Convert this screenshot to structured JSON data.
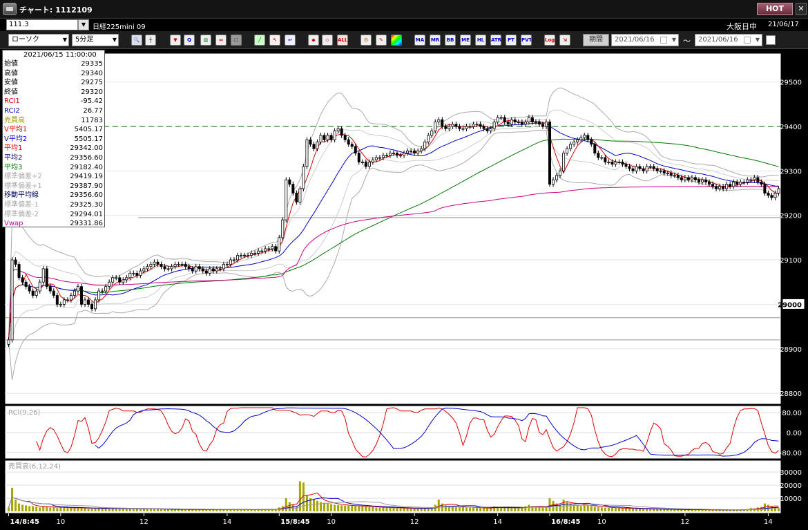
{
  "window": {
    "title": "チャート: 1112109",
    "hot_label": "HOT",
    "close_label": "✕"
  },
  "header": {
    "code": "111.3",
    "symbol": "日経225mini 09",
    "market": "大阪日中",
    "date": "21/06/17"
  },
  "toolbar": {
    "chart_type": "ローソク",
    "interval": "5分足",
    "period_label": "期間",
    "date_from": "2021/06/16",
    "date_to": "2021/06/16",
    "tilde": "～",
    "buttons": [
      "zoom",
      "cursor",
      "buy",
      "sell",
      "compare",
      "scale",
      "delete",
      "draw",
      "pointer",
      "arrow",
      "order1",
      "order2",
      "all",
      "settings",
      "tools",
      "color",
      "MA",
      "MR",
      "BB",
      "ME",
      "HL",
      "ATR",
      "PT",
      "PVT",
      "Log",
      "export"
    ],
    "button_labels": {
      "all": "ALL",
      "ma": "MA",
      "mr": "MR",
      "bb": "BB",
      "me": "ME",
      "hl": "HL",
      "atr": "ATR",
      "pt": "PT",
      "pvt": "PVT",
      "log": "Log"
    }
  },
  "info": {
    "datetime": "2021/06/15 11:00:00",
    "rows": [
      {
        "label": "始値",
        "value": "29335",
        "color": "#000000"
      },
      {
        "label": "高値",
        "value": "29340",
        "color": "#000000"
      },
      {
        "label": "安値",
        "value": "29275",
        "color": "#000000"
      },
      {
        "label": "終値",
        "value": "29320",
        "color": "#000000"
      },
      {
        "label": "RCI1",
        "value": "-95.42",
        "color": "#dd0000"
      },
      {
        "label": "RCI2",
        "value": "26.77",
        "color": "#0000cc"
      },
      {
        "label": "売買高",
        "value": "11783",
        "color": "#999900"
      },
      {
        "label": "V平均1",
        "value": "5405.17",
        "color": "#dd0000"
      },
      {
        "label": "V平均2",
        "value": "5505.17",
        "color": "#0000cc"
      },
      {
        "label": "平均1",
        "value": "29342.00",
        "color": "#dd0000"
      },
      {
        "label": "平均2",
        "value": "29356.60",
        "color": "#000066"
      },
      {
        "label": "平均3",
        "value": "29182.40",
        "color": "#007700"
      },
      {
        "label": "標準偏差+2",
        "value": "29419.19",
        "color": "#aaaaaa"
      },
      {
        "label": "標準偏差+1",
        "value": "29387.90",
        "color": "#aaaaaa"
      },
      {
        "label": "移動平均線",
        "value": "29356.60",
        "color": "#000066"
      },
      {
        "label": "標準偏差-1",
        "value": "29325.30",
        "color": "#aaaaaa"
      },
      {
        "label": "標準偏差-2",
        "value": "29294.01",
        "color": "#aaaaaa"
      },
      {
        "label": "Vwap",
        "value": "29331.86",
        "color": "#cc00aa"
      }
    ]
  },
  "chart_data": {
    "type": "candlestick",
    "price_axis": {
      "ylim": [
        28780,
        29560
      ],
      "ticks": [
        "29500",
        "29400",
        "29300",
        "29200",
        "29100",
        "29000",
        "28900",
        "28800"
      ],
      "highlight": "29000"
    },
    "rci": {
      "label": "RCI(9,26)",
      "ylim": [
        -100,
        100
      ],
      "ticks": [
        "80.00",
        "0.00",
        "-80.00"
      ]
    },
    "volume": {
      "label": "売買高(6,12,24)",
      "ylim": [
        0,
        38000
      ],
      "ticks": [
        "30000",
        "20000",
        "10000"
      ]
    },
    "x_labels": [
      {
        "i": 0,
        "t": "14/8:45",
        "b": 1
      },
      {
        "i": 15,
        "t": "10",
        "b": 0
      },
      {
        "i": 39,
        "t": "12",
        "b": 0
      },
      {
        "i": 63,
        "t": "14",
        "b": 0
      },
      {
        "i": 78,
        "t": "15/8:45",
        "b": 1
      },
      {
        "i": 93,
        "t": "10",
        "b": 0
      },
      {
        "i": 117,
        "t": "12",
        "b": 0
      },
      {
        "i": 141,
        "t": "14",
        "b": 0
      },
      {
        "i": 156,
        "t": "16/8:45",
        "b": 1
      },
      {
        "i": 171,
        "t": "10",
        "b": 0
      },
      {
        "i": 195,
        "t": "12",
        "b": 0
      },
      {
        "i": 219,
        "t": "14",
        "b": 0
      }
    ],
    "dashed_level": 29400,
    "closes": [
      28920,
      29100,
      29090,
      29060,
      29050,
      29040,
      29030,
      29020,
      29030,
      29050,
      29080,
      29040,
      29030,
      29020,
      29000,
      29000,
      29010,
      29010,
      29020,
      29030,
      29040,
      29000,
      29010,
      29000,
      28990,
      29010,
      29030,
      29030,
      29040,
      29050,
      29060,
      29060,
      29050,
      29055,
      29060,
      29070,
      29070,
      29065,
      29075,
      29080,
      29085,
      29090,
      29095,
      29090,
      29085,
      29080,
      29080,
      29085,
      29090,
      29090,
      29090,
      29085,
      29080,
      29075,
      29085,
      29080,
      29075,
      29070,
      29080,
      29075,
      29080,
      29080,
      29090,
      29090,
      29100,
      29100,
      29110,
      29110,
      29110,
      29110,
      29115,
      29115,
      29120,
      29120,
      29125,
      29125,
      29130,
      29120,
      29150,
      29190,
      29280,
      29270,
      29250,
      29230,
      29260,
      29310,
      29370,
      29360,
      29350,
      29365,
      29380,
      29370,
      29380,
      29370,
      29390,
      29395,
      29380,
      29370,
      29360,
      29355,
      29340,
      29320,
      29320,
      29310,
      29320,
      29325,
      29330,
      29330,
      29335,
      29335,
      29340,
      29340,
      29335,
      29335,
      29340,
      29345,
      29345,
      29340,
      29345,
      29350,
      29365,
      29380,
      29390,
      29410,
      29415,
      29400,
      29395,
      29400,
      29405,
      29400,
      29395,
      29395,
      29400,
      29400,
      29405,
      29405,
      29400,
      29395,
      29390,
      29395,
      29410,
      29420,
      29420,
      29410,
      29405,
      29415,
      29410,
      29410,
      29405,
      29410,
      29420,
      29410,
      29410,
      29405,
      29400,
      29410,
      29270,
      29280,
      29290,
      29300,
      29340,
      29350,
      29360,
      29365,
      29370,
      29375,
      29380,
      29370,
      29360,
      29340,
      29330,
      29330,
      29320,
      29320,
      29315,
      29320,
      29320,
      29315,
      29310,
      29305,
      29300,
      29310,
      29305,
      29300,
      29310,
      29310,
      29305,
      29300,
      29300,
      29295,
      29295,
      29290,
      29290,
      29285,
      29280,
      29285,
      29280,
      29285,
      29280,
      29275,
      29280,
      29275,
      29270,
      29265,
      29260,
      29265,
      29260,
      29270,
      29265,
      29275,
      29270,
      29275,
      29275,
      29280,
      29280,
      29285,
      29275,
      29270,
      29250,
      29245,
      29240,
      29250,
      29260
    ],
    "volumes": [
      3000,
      18000,
      9000,
      6000,
      5000,
      4500,
      4000,
      4000,
      3500,
      3000,
      4000,
      3500,
      3000,
      3000,
      2500,
      3000,
      3000,
      2500,
      2500,
      2500,
      3000,
      2500,
      2500,
      2000,
      2000,
      2500,
      2000,
      2500,
      2000,
      2000,
      2000,
      2500,
      2000,
      2000,
      1800,
      2000,
      2000,
      1800,
      2000,
      1800,
      2000,
      2000,
      1800,
      1600,
      1500,
      1500,
      1600,
      1500,
      1500,
      1600,
      1500,
      1400,
      1500,
      1600,
      1400,
      1500,
      1400,
      1500,
      1400,
      1500,
      1400,
      1500,
      1400,
      1400,
      1300,
      1400,
      1300,
      1400,
      1300,
      1400,
      1300,
      1300,
      1400,
      1500,
      1500,
      1400,
      1600,
      1800,
      3000,
      4000,
      10000,
      7000,
      5000,
      4000,
      23000,
      22000,
      12000,
      10000,
      9000,
      8000,
      7000,
      6500,
      6000,
      5500,
      5000,
      4800,
      4600,
      4400,
      4300,
      4200,
      4100,
      4000,
      3800,
      3600,
      3400,
      3200,
      3000,
      2900,
      3000,
      2800,
      2700,
      2600,
      2500,
      2400,
      2300,
      2200,
      2200,
      2100,
      2200,
      2300,
      2500,
      2700,
      3000,
      5000,
      9000,
      6000,
      4500,
      4000,
      3800,
      3600,
      3400,
      3200,
      3000,
      2800,
      2700,
      2600,
      2500,
      2400,
      2300,
      2500,
      4000,
      3500,
      3000,
      2800,
      2600,
      2500,
      3000,
      2800,
      2600,
      4000,
      5000,
      4000,
      3500,
      3000,
      2800,
      3000,
      10000,
      8000,
      6000,
      5000,
      9000,
      7000,
      6000,
      5000,
      4500,
      4000,
      5000,
      4500,
      4000,
      3500,
      3200,
      3000,
      2800,
      2700,
      2600,
      2500,
      2400,
      2300,
      2200,
      2100,
      2000,
      2000,
      1900,
      1800,
      1800,
      1700,
      1700,
      1600,
      1600,
      1500,
      1500,
      1500,
      1400,
      1400,
      1400,
      1300,
      1300,
      1300,
      1300,
      1200,
      1200,
      1200,
      1200,
      1100,
      1100,
      1100,
      1200,
      1300,
      1200,
      1100,
      1200,
      1300,
      1400,
      1800,
      2500,
      2200,
      3000,
      3500,
      6000,
      5000,
      4000,
      3000,
      2500
    ]
  }
}
